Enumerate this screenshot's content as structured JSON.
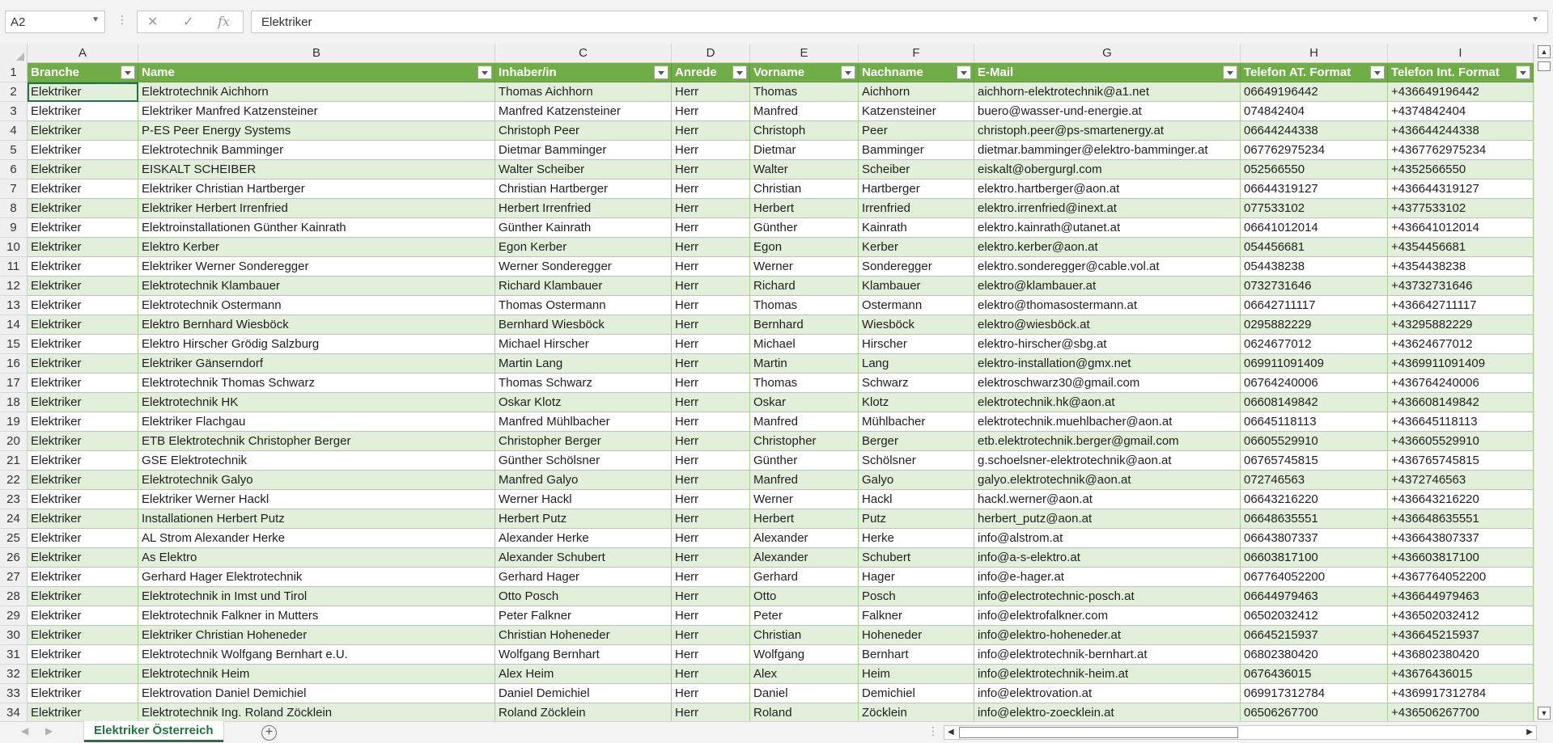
{
  "formula_bar": {
    "name_box": "A2",
    "cancel_icon": "✕",
    "enter_icon": "✓",
    "function_icon": "fx",
    "value": "Elektriker"
  },
  "columns": [
    "A",
    "B",
    "C",
    "D",
    "E",
    "F",
    "G",
    "H",
    "I"
  ],
  "headers": [
    "Branche",
    "Name",
    "Inhaber/in",
    "Anrede",
    "Vorname",
    "Nachname",
    "E-Mail",
    "Telefon AT. Format",
    "Telefon Int. Format"
  ],
  "rows": [
    {
      "n": "2",
      "c": [
        "Elektriker",
        "Elektrotechnik Aichhorn",
        "Thomas Aichhorn",
        "Herr",
        "Thomas",
        "Aichhorn",
        "aichhorn-elektrotechnik@a1.net",
        "06649196442",
        "+436649196442"
      ]
    },
    {
      "n": "3",
      "c": [
        "Elektriker",
        "Elektriker Manfred Katzensteiner",
        "Manfred Katzensteiner",
        "Herr",
        "Manfred",
        "Katzensteiner",
        "buero@wasser-und-energie.at",
        "074842404",
        "+4374842404"
      ]
    },
    {
      "n": "4",
      "c": [
        "Elektriker",
        "P-ES Peer Energy Systems",
        "Christoph Peer",
        "Herr",
        "Christoph",
        "Peer",
        "christoph.peer@ps-smartenergy.at",
        "06644244338",
        "+436644244338"
      ]
    },
    {
      "n": "5",
      "c": [
        "Elektriker",
        "Elektrotechnik Bamminger",
        "Dietmar Bamminger",
        "Herr",
        "Dietmar",
        "Bamminger",
        "dietmar.bamminger@elektro-bamminger.at",
        "067762975234",
        "+4367762975234"
      ]
    },
    {
      "n": "6",
      "c": [
        "Elektriker",
        "EISKALT SCHEIBER",
        "Walter Scheiber",
        "Herr",
        "Walter",
        "Scheiber",
        "eiskalt@obergurgl.com",
        "052566550",
        "+4352566550"
      ]
    },
    {
      "n": "7",
      "c": [
        "Elektriker",
        "Elektriker Christian Hartberger",
        "Christian Hartberger",
        "Herr",
        "Christian",
        "Hartberger",
        "elektro.hartberger@aon.at",
        "06644319127",
        "+436644319127"
      ]
    },
    {
      "n": "8",
      "c": [
        "Elektriker",
        "Elektriker Herbert Irrenfried",
        "Herbert Irrenfried",
        "Herr",
        "Herbert",
        "Irrenfried",
        "elektro.irrenfried@inext.at",
        "077533102",
        "+4377533102"
      ]
    },
    {
      "n": "9",
      "c": [
        "Elektriker",
        "Elektroinstallationen Günther Kainrath",
        "Günther Kainrath",
        "Herr",
        "Günther",
        "Kainrath",
        "elektro.kainrath@utanet.at",
        "06641012014",
        "+436641012014"
      ]
    },
    {
      "n": "10",
      "c": [
        "Elektriker",
        "Elektro Kerber",
        "Egon Kerber",
        "Herr",
        "Egon",
        "Kerber",
        "elektro.kerber@aon.at",
        "054456681",
        "+4354456681"
      ]
    },
    {
      "n": "11",
      "c": [
        "Elektriker",
        "Elektriker Werner Sonderegger",
        "Werner Sonderegger",
        "Herr",
        "Werner",
        "Sonderegger",
        "elektro.sonderegger@cable.vol.at",
        "054438238",
        "+4354438238"
      ]
    },
    {
      "n": "12",
      "c": [
        "Elektriker",
        "Elektrotechnik Klambauer",
        "Richard Klambauer",
        "Herr",
        "Richard",
        "Klambauer",
        "elektro@klambauer.at",
        "0732731646",
        "+43732731646"
      ]
    },
    {
      "n": "13",
      "c": [
        "Elektriker",
        "Elektrotechnik Ostermann",
        "Thomas Ostermann",
        "Herr",
        "Thomas",
        "Ostermann",
        "elektro@thomasostermann.at",
        "06642711117",
        "+436642711117"
      ]
    },
    {
      "n": "14",
      "c": [
        "Elektriker",
        "Elektro Bernhard Wiesböck",
        "Bernhard Wiesböck",
        "Herr",
        "Bernhard",
        "Wiesböck",
        "elektro@wiesböck.at",
        "0295882229",
        "+43295882229"
      ]
    },
    {
      "n": "15",
      "c": [
        "Elektriker",
        "Elektro Hirscher Grödig Salzburg",
        "Michael Hirscher",
        "Herr",
        "Michael",
        "Hirscher",
        "elektro-hirscher@sbg.at",
        "0624677012",
        "+43624677012"
      ]
    },
    {
      "n": "16",
      "c": [
        "Elektriker",
        "Elektriker Gänserndorf",
        "Martin Lang",
        "Herr",
        "Martin",
        "Lang",
        "elektro-installation@gmx.net",
        "069911091409",
        "+4369911091409"
      ]
    },
    {
      "n": "17",
      "c": [
        "Elektriker",
        "Elektrotechnik Thomas Schwarz",
        "Thomas Schwarz",
        "Herr",
        "Thomas",
        "Schwarz",
        "elektroschwarz30@gmail.com",
        "06764240006",
        "+436764240006"
      ]
    },
    {
      "n": "18",
      "c": [
        "Elektriker",
        "Elektrotechnik HK",
        "Oskar Klotz",
        "Herr",
        "Oskar",
        "Klotz",
        "elektrotechnik.hk@aon.at",
        "06608149842",
        "+436608149842"
      ]
    },
    {
      "n": "19",
      "c": [
        "Elektriker",
        "Elektriker Flachgau",
        "Manfred Mühlbacher",
        "Herr",
        "Manfred",
        "Mühlbacher",
        "elektrotechnik.muehlbacher@aon.at",
        "06645118113",
        "+436645118113"
      ]
    },
    {
      "n": "20",
      "c": [
        "Elektriker",
        "ETB Elektrotechnik Christopher Berger",
        "Christopher Berger",
        "Herr",
        "Christopher",
        "Berger",
        "etb.elektrotechnik.berger@gmail.com",
        "06605529910",
        "+436605529910"
      ]
    },
    {
      "n": "21",
      "c": [
        "Elektriker",
        "GSE Elektrotechnik",
        "Günther Schölsner",
        "Herr",
        "Günther",
        "Schölsner",
        "g.schoelsner-elektrotechnik@aon.at",
        "06765745815",
        "+436765745815"
      ]
    },
    {
      "n": "22",
      "c": [
        "Elektriker",
        "Elektrotechnik Galyo",
        "Manfred Galyo",
        "Herr",
        "Manfred",
        "Galyo",
        "galyo.elektrotechnik@aon.at",
        "072746563",
        "+4372746563"
      ]
    },
    {
      "n": "23",
      "c": [
        "Elektriker",
        "Elektriker Werner Hackl",
        "Werner Hackl",
        "Herr",
        "Werner",
        "Hackl",
        "hackl.werner@aon.at",
        "06643216220",
        "+436643216220"
      ]
    },
    {
      "n": "24",
      "c": [
        "Elektriker",
        "Installationen Herbert Putz",
        "Herbert Putz",
        "Herr",
        "Herbert",
        "Putz",
        "herbert_putz@aon.at",
        "06648635551",
        "+436648635551"
      ]
    },
    {
      "n": "25",
      "c": [
        "Elektriker",
        "AL Strom Alexander Herke",
        "Alexander Herke",
        "Herr",
        "Alexander",
        "Herke",
        "info@alstrom.at",
        "06643807337",
        "+436643807337"
      ]
    },
    {
      "n": "26",
      "c": [
        "Elektriker",
        "As Elektro",
        "Alexander Schubert",
        "Herr",
        "Alexander",
        "Schubert",
        "info@a-s-elektro.at",
        "06603817100",
        "+436603817100"
      ]
    },
    {
      "n": "27",
      "c": [
        "Elektriker",
        "Gerhard Hager Elektrotechnik",
        "Gerhard Hager",
        "Herr",
        "Gerhard",
        "Hager",
        "info@e-hager.at",
        "067764052200",
        "+4367764052200"
      ]
    },
    {
      "n": "28",
      "c": [
        "Elektriker",
        "Elektrotechnik in Imst und Tirol",
        "Otto Posch",
        "Herr",
        "Otto",
        "Posch",
        "info@electrotechnic-posch.at",
        "06644979463",
        "+436644979463"
      ]
    },
    {
      "n": "29",
      "c": [
        "Elektriker",
        "Elektrotechnik Falkner in Mutters",
        "Peter Falkner",
        "Herr",
        "Peter",
        "Falkner",
        "info@elektrofalkner.com",
        "06502032412",
        "+436502032412"
      ]
    },
    {
      "n": "30",
      "c": [
        "Elektriker",
        "Elektriker Christian Hoheneder",
        "Christian Hoheneder",
        "Herr",
        "Christian",
        "Hoheneder",
        "info@elektro-hoheneder.at",
        "06645215937",
        "+436645215937"
      ]
    },
    {
      "n": "31",
      "c": [
        "Elektriker",
        "Elektrotechnik Wolfgang Bernhart e.U.",
        "Wolfgang Bernhart",
        "Herr",
        "Wolfgang",
        "Bernhart",
        "info@elektrotechnik-bernhart.at",
        "06802380420",
        "+436802380420"
      ]
    },
    {
      "n": "32",
      "c": [
        "Elektriker",
        "Elektrotechnik Heim",
        "Alex Heim",
        "Herr",
        "Alex",
        "Heim",
        "info@elektrotechnik-heim.at",
        "0676436015",
        "+43676436015"
      ]
    },
    {
      "n": "33",
      "c": [
        "Elektriker",
        "Elektrovation Daniel Demichiel",
        "Daniel Demichiel",
        "Herr",
        "Daniel",
        "Demichiel",
        "info@elektrovation.at",
        "069917312784",
        "+4369917312784"
      ]
    },
    {
      "n": "34",
      "c": [
        "Elektriker",
        "Elektrotechnik Ing. Roland Zöcklein",
        "Roland Zöcklein",
        "Herr",
        "Roland",
        "Zöcklein",
        "info@elektro-zoecklein.at",
        "06506267700",
        "+436506267700"
      ]
    }
  ],
  "header_row_number": "1",
  "sheet_tab": "Elektriker Österreich",
  "colors": {
    "accent": "#217346",
    "table_header": "#70ad47",
    "band": "#e2efda"
  }
}
